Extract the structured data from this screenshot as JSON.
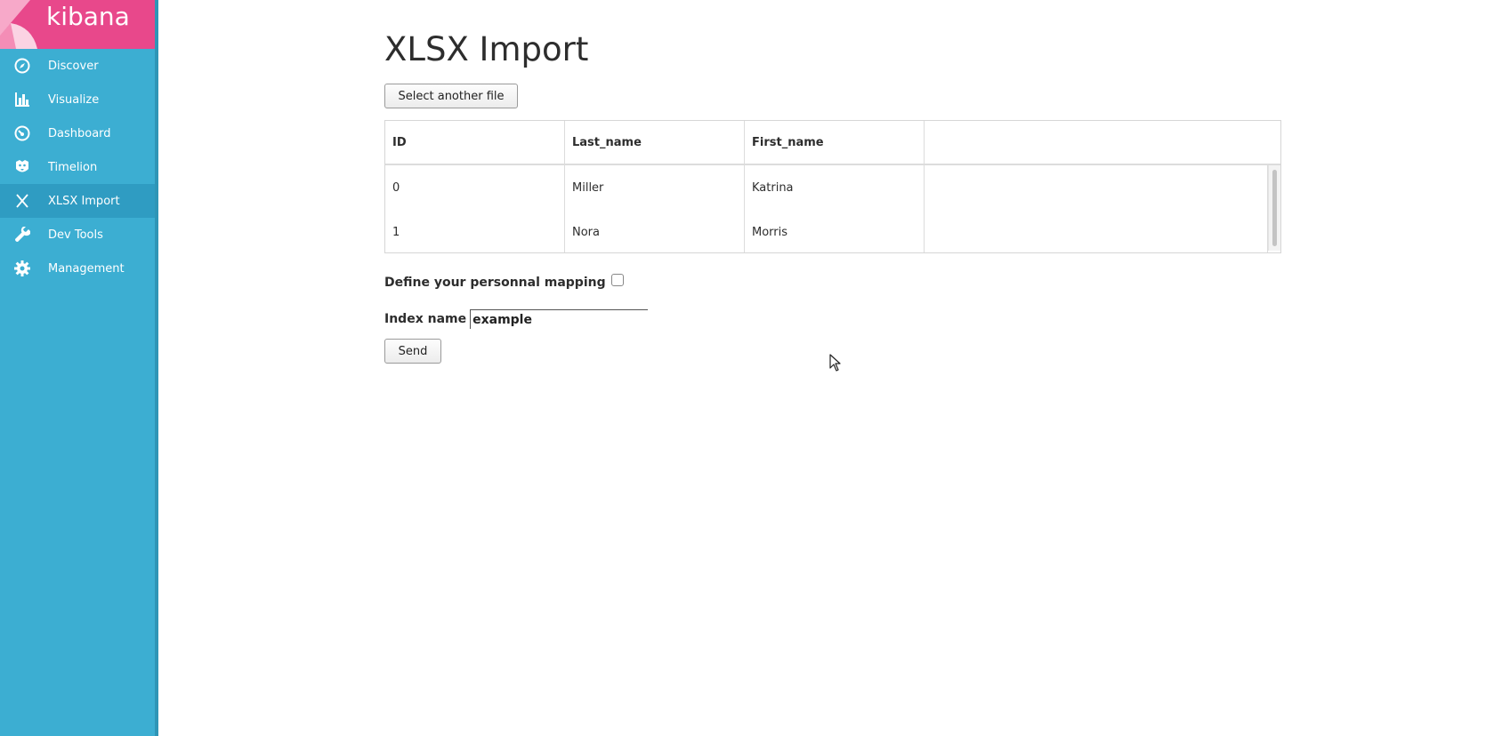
{
  "sidebar": {
    "logo_text": "kibana",
    "items": [
      {
        "label": "Discover",
        "icon": "compass-icon"
      },
      {
        "label": "Visualize",
        "icon": "bar-chart-icon"
      },
      {
        "label": "Dashboard",
        "icon": "gauge-icon"
      },
      {
        "label": "Timelion",
        "icon": "timelion-icon"
      },
      {
        "label": "XLSX Import",
        "icon": "x-icon",
        "active": true
      },
      {
        "label": "Dev Tools",
        "icon": "wrench-icon"
      },
      {
        "label": "Management",
        "icon": "gear-icon"
      }
    ]
  },
  "main": {
    "title": "XLSX Import",
    "select_file_label": "Select another file",
    "table": {
      "headers": [
        "ID",
        "Last_name",
        "First_name",
        ""
      ],
      "rows": [
        [
          "0",
          "Miller",
          "Katrina",
          ""
        ],
        [
          "1",
          "Nora",
          "Morris",
          ""
        ]
      ]
    },
    "mapping_label": "Define your personnal mapping",
    "index_label": "Index name",
    "index_value": "example",
    "send_label": "Send"
  },
  "colors": {
    "sidebar": "#3caed2",
    "sidebar_active": "#2f9cc2",
    "logo": "#e8488b"
  }
}
